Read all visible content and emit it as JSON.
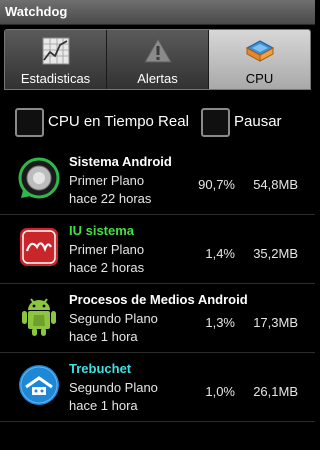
{
  "window": {
    "title": "Watchdog"
  },
  "tabs": [
    {
      "label": "Estadisticas",
      "icon": "statistics-icon",
      "active": false
    },
    {
      "label": "Alertas",
      "icon": "warning-icon",
      "active": false
    },
    {
      "label": "CPU",
      "icon": "cpu-chip-icon",
      "active": true
    }
  ],
  "options": {
    "realtime_label": "CPU en Tiempo Real",
    "realtime_checked": false,
    "pause_label": "Pausar",
    "pause_checked": false
  },
  "processes": [
    {
      "name": "Sistema Android",
      "name_color": "#ffffff",
      "mode": "Primer Plano",
      "since": "hace 22 horas",
      "cpu": "90,7%",
      "mem": "54,8MB",
      "icon": "android-system-icon"
    },
    {
      "name": "IU sistema",
      "name_color": "#3ee23e",
      "mode": "Primer Plano",
      "since": "hace 2 horas",
      "cpu": "1,4%",
      "mem": "35,2MB",
      "icon": "android-kitkat-icon"
    },
    {
      "name": "Procesos de Medios Android",
      "name_color": "#ffffff",
      "mode": "Segundo Plano",
      "since": "hace 1 hora",
      "cpu": "1,3%",
      "mem": "17,3MB",
      "icon": "android-robot-icon"
    },
    {
      "name": "Trebuchet",
      "name_color": "#3fe0e0",
      "mode": "Segundo Plano",
      "since": "hace 1 hora",
      "cpu": "1,0%",
      "mem": "26,1MB",
      "icon": "trebuchet-launcher-icon"
    }
  ],
  "colors": {
    "active_tab": "#c4c4c4",
    "accent_green": "#3ee23e",
    "accent_cyan": "#3fe0e0"
  }
}
